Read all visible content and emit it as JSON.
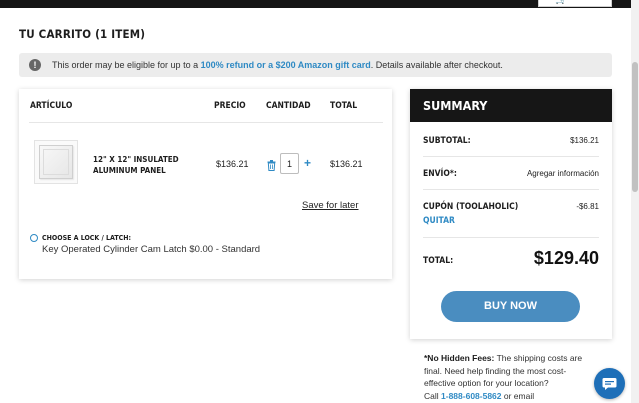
{
  "header": {
    "cart_icon": "cart-icon"
  },
  "cart": {
    "title": "TU CARRITO (1 ITEM)",
    "notice": {
      "icon": "info-icon",
      "icon_glyph": "!",
      "prefix": "This order may be eligible for up to a ",
      "link": "100% refund or a $200 Amazon gift card",
      "suffix": ". Details available after checkout."
    },
    "columns": {
      "item": "ARTÍCULO",
      "price": "PRECIO",
      "quantity": "CANTIDAD",
      "total": "TOTAL"
    },
    "item": {
      "name": "12\" X 12\" INSULATED ALUMINUM PANEL",
      "price": "$136.21",
      "quantity": "1",
      "total": "$136.21",
      "save_for_later": "Save for later",
      "option_label": "CHOOSE A LOCK / LATCH:",
      "option_value": "Key Operated Cylinder Cam Latch $0.00 - Standard"
    }
  },
  "summary": {
    "title": "SUMMARY",
    "subtotal_label": "SUBTOTAL:",
    "subtotal_value": "$136.21",
    "shipping_label": "ENVÍO*:",
    "shipping_value": "Agregar información",
    "coupon_label": "CUPÓN (TOOLAHOLIC)",
    "coupon_value": "-$6.81",
    "remove_label": "QUITAR",
    "total_label": "TOTAL:",
    "total_value": "$129.40",
    "buy_label": "BUY NOW"
  },
  "fees": {
    "bold": "*No Hidden Fees:",
    "text": " The shipping costs are final. Need help finding the most cost-effective option for your location?",
    "call_prefix": "Call ",
    "phone": "1-888-608-5862",
    "call_suffix": " or email"
  },
  "colors": {
    "accent": "#2f8ac4",
    "button": "#4a8dc0",
    "dark": "#161616",
    "chat": "#1e6fb8"
  }
}
